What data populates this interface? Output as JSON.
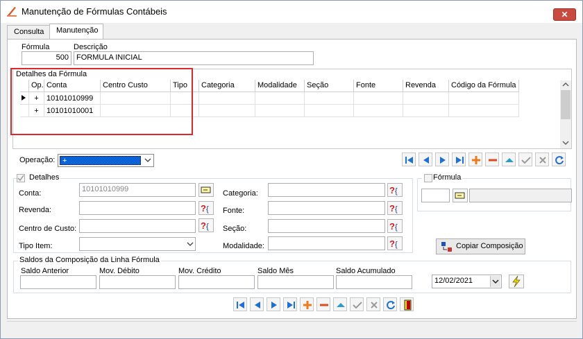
{
  "window": {
    "title": "Manutenção de Fórmulas Contábeis",
    "close_label": "✕"
  },
  "tabs": [
    {
      "label": "Consulta"
    },
    {
      "label": "Manutenção"
    }
  ],
  "header": {
    "formula_label": "Fórmula",
    "formula_value": "500",
    "descricao_label": "Descrição",
    "descricao_value": "FORMULA INICIAL"
  },
  "detalhes_formula": {
    "title": "Detalhes da Fórmula",
    "columns": [
      "Op.",
      "Conta",
      "Centro Custo",
      "Tipo",
      "Categoria",
      "Modalidade",
      "Seção",
      "Fonte",
      "Revenda",
      "Código da Fórmula"
    ],
    "rows": [
      {
        "op": "+",
        "conta": "10101010999"
      },
      {
        "op": "+",
        "conta": "10101010001"
      }
    ]
  },
  "operacao": {
    "label": "Operação:",
    "value": "+"
  },
  "detalhes": {
    "title": "Detalhes",
    "conta_label": "Conta:",
    "conta_value": "10101010999",
    "revenda_label": "Revenda:",
    "centro_label": "Centro de Custo:",
    "tipo_label": "Tipo Item:",
    "categoria_label": "Categoria:",
    "fonte_label": "Fonte:",
    "secao_label": "Seção:",
    "modalidade_label": "Modalidade:"
  },
  "formula_group": {
    "title": "Fórmula"
  },
  "copiar_label": "Copiar Composição",
  "saldos": {
    "title": "Saldos da Composição da Linha Fórmula",
    "saldo_anterior": "Saldo Anterior",
    "mov_debito": "Mov. Débito",
    "mov_credito": "Mov. Crédito",
    "saldo_mes": "Saldo Mês",
    "saldo_acumulado": "Saldo Acumulado",
    "date": "12/02/2021"
  },
  "colors": {
    "highlight_box": "#e0252b",
    "selection": "#0a64d8",
    "nav_blue": "#1e6fd9",
    "add_orange": "#f07a1a"
  }
}
